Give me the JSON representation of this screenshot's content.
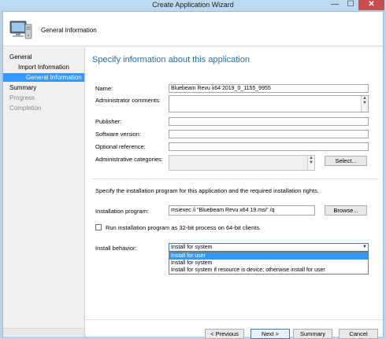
{
  "window": {
    "title": "Create Application Wizard",
    "minimize_glyph": "—",
    "maximize_glyph": "☐",
    "close_glyph": "✕"
  },
  "header": {
    "title": "General Information",
    "icon": "computer-icon"
  },
  "nav": {
    "items": [
      {
        "label": "General"
      },
      {
        "label": "Import Information"
      },
      {
        "label": "General Information"
      },
      {
        "label": "Summary"
      },
      {
        "label": "Progress"
      },
      {
        "label": "Completion"
      }
    ]
  },
  "page": {
    "heading": "Specify information about this application"
  },
  "form": {
    "name_label": "Name:",
    "name_value": "Bluebeam Revu x64 2019_0_1155_9955",
    "admin_comments_label": "Administrator comments:",
    "admin_comments_value": "",
    "publisher_label": "Publisher:",
    "publisher_value": "",
    "software_version_label": "Software version:",
    "software_version_value": "",
    "optional_reference_label": "Optional reference:",
    "optional_reference_value": "",
    "admin_categories_label": "Administrative categories:",
    "admin_categories_value": "",
    "select_button": "Select..."
  },
  "install": {
    "description": "Specify the installation program for this application and the required installation rights.",
    "program_label": "Installation program:",
    "program_value": "msiexec /i \"Bluebeam Revu x64 19.msi\" /q",
    "browse_button": "Browse...",
    "run_32bit_label": "Run installation program as 32-bit process on 64-bit clients.",
    "run_32bit_checked": false,
    "behavior_label": "Install behavior:",
    "behavior_selected": "Install for system",
    "behavior_options": [
      "Install for user",
      "Install for system",
      "Install for system if resource is device; otherwise install for user"
    ],
    "behavior_highlighted_option": "Install for user"
  },
  "footer": {
    "previous": "< Previous",
    "next": "Next >",
    "summary": "Summary",
    "cancel": "Cancel"
  }
}
